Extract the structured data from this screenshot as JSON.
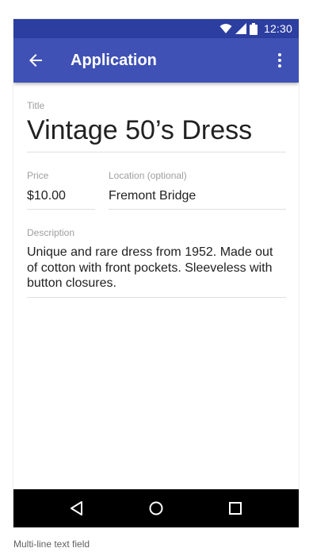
{
  "status_bar": {
    "time": "12:30",
    "icons": [
      "wifi-icon",
      "signal-icon",
      "battery-icon"
    ]
  },
  "app_bar": {
    "title": "Application",
    "color": "#3f51b5",
    "status_color": "#2c3ea0",
    "back_icon": "arrow-back-icon",
    "menu_icon": "more-vert-icon"
  },
  "form": {
    "title": {
      "label": "Title",
      "value": "Vintage 50’s Dress"
    },
    "price": {
      "label": "Price",
      "value": "$10.00"
    },
    "location": {
      "label": "Location (optional)",
      "value": "Fremont Bridge"
    },
    "description": {
      "label": "Description",
      "value": "Unique and rare dress from 1952. Made out of cotton with front pockets. Sleeveless with button closures."
    }
  },
  "nav_bar": {
    "icons": [
      "back-triangle-icon",
      "home-circle-icon",
      "recents-square-icon"
    ]
  },
  "caption": "Multi-line text field"
}
